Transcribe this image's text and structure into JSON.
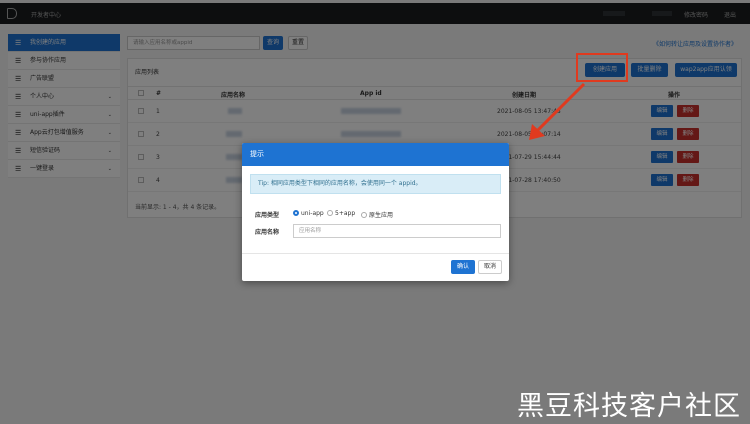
{
  "topbar": {
    "title": "开发者中心",
    "modify_password": "修改密码",
    "logout": "退出"
  },
  "sidebar": {
    "items": [
      {
        "label": "我创建的应用",
        "icon": "menu-icon"
      },
      {
        "label": "参与协作应用",
        "icon": "menu-icon"
      },
      {
        "label": "广告联盟",
        "icon": "menu-icon"
      },
      {
        "label": "个人中心",
        "icon": "menu-icon"
      },
      {
        "label": "uni-app插件",
        "icon": "menu-icon"
      },
      {
        "label": "App云打包增值服务",
        "icon": "menu-icon"
      },
      {
        "label": "短信验证码",
        "icon": "menu-icon"
      },
      {
        "label": "一键登录",
        "icon": "menu-icon"
      }
    ]
  },
  "search": {
    "placeholder": "请输入应用名称或appid",
    "query_label": "查询",
    "reset_label": "重置"
  },
  "help_link": "《如何转让应用及设置协作者》",
  "panel": {
    "title": "应用列表",
    "create_label": "创建应用",
    "batch_delete_label": "批量删除",
    "wap2app_label": "wap2app应用认领"
  },
  "table": {
    "headers": [
      "#",
      "应用名称",
      "App id",
      "创建日期",
      "操作"
    ],
    "rows": [
      {
        "num": "1",
        "date": "2021-08-05 13:47:48"
      },
      {
        "num": "2",
        "date": "2021-08-05 10:07:14"
      },
      {
        "num": "3",
        "date": "2021-07-29 15:44:44"
      },
      {
        "num": "4",
        "date": "2021-07-28 17:40:50"
      }
    ],
    "edit_label": "编辑",
    "delete_label": "删除",
    "count_text": "当前显示: 1 - 4，共 4 条记录。"
  },
  "dialog": {
    "title": "提示",
    "tip": "Tip: 相同应用类型下相同的应用名称，会使用同一个 appid。",
    "type_label": "应用类型",
    "types": [
      "uni-app",
      "5+app",
      "原生应用"
    ],
    "selected_type": "uni-app",
    "name_label": "应用名称",
    "name_placeholder": "应用名称",
    "ok_label": "确认",
    "cancel_label": "取消"
  },
  "annotation": {
    "highlight_color": "#e03a1f"
  },
  "watermark": "黑豆科技客户社区"
}
